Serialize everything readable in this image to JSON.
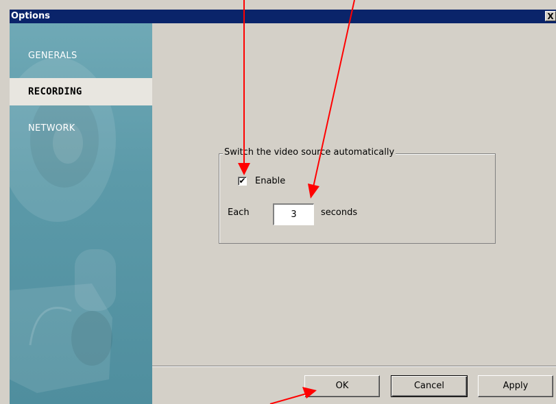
{
  "window": {
    "title": "Options",
    "close_label": "X"
  },
  "sidebar": {
    "items": [
      {
        "label": "GENERALS",
        "active": false
      },
      {
        "label": "RECORDING",
        "active": true
      },
      {
        "label": "NETWORK",
        "active": false
      }
    ]
  },
  "recording": {
    "group_title": "Switch the video source automatically",
    "enable_label": "Enable",
    "enable_checked": true,
    "checkbox_mark": "✔",
    "each_label": "Each",
    "interval_value": "3",
    "seconds_label": "seconds"
  },
  "buttons": {
    "ok": "OK",
    "cancel": "Cancel",
    "apply": "Apply"
  },
  "colors": {
    "titlebar": "#0a246a",
    "sidebar": "#5c9aa9",
    "dialog_bg": "#d4d0c8",
    "annotation_arrow": "#ff0000"
  }
}
